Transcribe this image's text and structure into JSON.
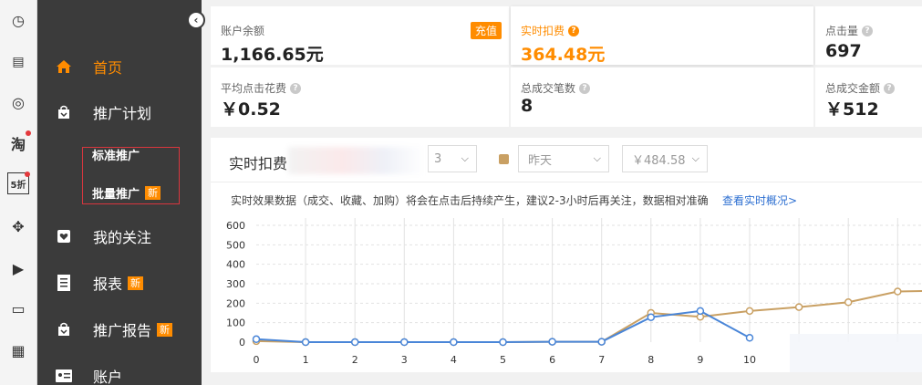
{
  "rail": {
    "icons": [
      {
        "name": "clock-icon",
        "glyph": "◷"
      },
      {
        "name": "news-icon",
        "glyph": "▤"
      },
      {
        "name": "chat-icon",
        "glyph": "◎"
      },
      {
        "name": "taobao-icon",
        "glyph": "淘"
      },
      {
        "name": "discount-icon",
        "glyph": "5折"
      },
      {
        "name": "gamepad-icon",
        "glyph": "✥"
      },
      {
        "name": "video-icon",
        "glyph": "▶"
      },
      {
        "name": "monitor-icon",
        "glyph": "▭"
      },
      {
        "name": "calculator-icon",
        "glyph": "▦"
      }
    ]
  },
  "sidebar": {
    "collapse_glyph": "‹",
    "items": [
      {
        "label": "首页",
        "icon": "home-icon"
      },
      {
        "label": "推广计划",
        "icon": "shopping-bag-icon"
      },
      {
        "label": "我的关注",
        "icon": "heart-icon"
      },
      {
        "label": "报表",
        "icon": "report-icon",
        "badge": "新"
      },
      {
        "label": "推广报告",
        "icon": "shopping-bag-icon",
        "badge": "新"
      },
      {
        "label": "账户",
        "icon": "id-card-icon"
      }
    ],
    "sub_items": [
      {
        "label": "标准推广"
      },
      {
        "label": "批量推广",
        "badge": "新"
      }
    ]
  },
  "stats": {
    "balance": {
      "label": "账户余额",
      "value": "1,166.65元",
      "action": "充值"
    },
    "realtime_cost": {
      "label": "实时扣费",
      "value": "364.48元"
    },
    "clicks": {
      "label": "点击量",
      "value": "697"
    },
    "avg_click_cost": {
      "label": "平均点击花费",
      "value": "￥0.52"
    },
    "deals": {
      "label": "总成交笔数",
      "value": "8"
    },
    "deal_amount": {
      "label": "总成交金额",
      "value": "￥512"
    }
  },
  "panel": {
    "title": "实时扣费",
    "select1_value": "3",
    "select2_value": "昨天",
    "select3_value": "￥484.58",
    "notice": "实时效果数据（成交、收藏、加购）将会在点击后持续产生，建议2-3小时后再关注，数据相对准确",
    "link": "查看实时概况>"
  },
  "colors": {
    "accent": "#ff8c00",
    "today_line": "#4a86d8",
    "yesterday_line": "#c9a063",
    "sidebar_bg": "#3b3b3b"
  },
  "chart_data": {
    "type": "line",
    "x": [
      0,
      1,
      2,
      3,
      4,
      5,
      6,
      7,
      8,
      9,
      10,
      11,
      12,
      13,
      14
    ],
    "x_ticks": [
      0,
      1,
      2,
      3,
      4,
      5,
      6,
      7,
      8,
      9,
      10
    ],
    "y_ticks": [
      0,
      100,
      200,
      300,
      400,
      500,
      600
    ],
    "ylim": [
      0,
      600
    ],
    "grid": true,
    "series": [
      {
        "values": [
          15,
          0,
          0,
          0,
          0,
          0,
          2,
          2,
          128,
          160,
          22
        ],
        "color": "#4a86d8"
      },
      {
        "values": [
          5,
          0,
          0,
          0,
          0,
          0,
          2,
          2,
          150,
          130,
          160,
          180,
          205,
          260,
          265
        ],
        "color": "#c9a063"
      }
    ]
  }
}
